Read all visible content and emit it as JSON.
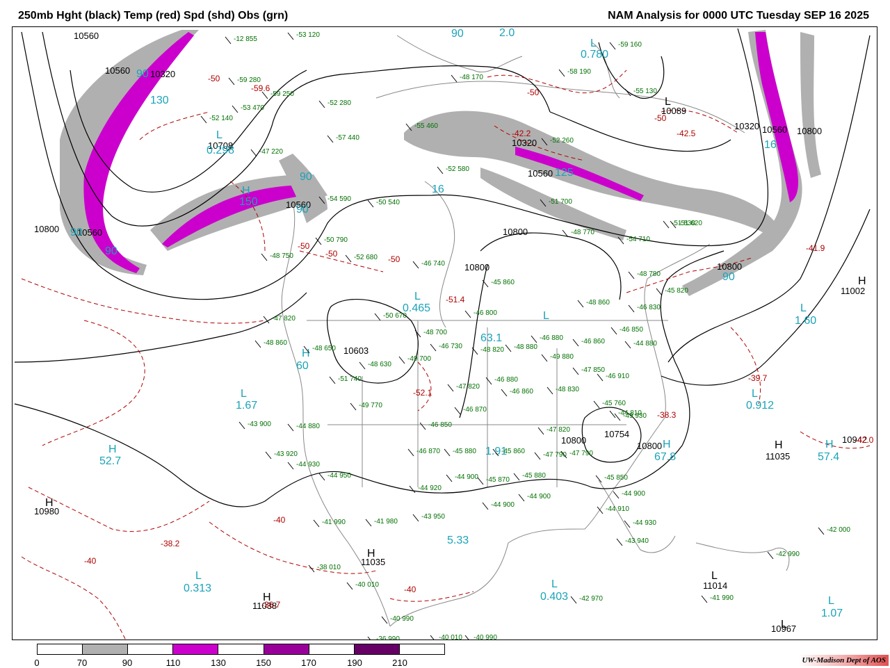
{
  "title_left": "250mb Hght (black) Temp (red) Spd (shd) Obs (grn)",
  "title_right": "NAM Analysis for 0000 UTC Tuesday  SEP 16 2025",
  "credit": "UW-Madison  Dept of AOS",
  "colors": {
    "height": "#000000",
    "temperature": "#b00000",
    "speed_label": "#1aa3b8",
    "obs": "#007000",
    "shade_70": "#b0b0b0",
    "shade_110": "#cc00cc",
    "shade_150": "#990099",
    "shade_190": "#660066",
    "border": "#888888"
  },
  "scale": {
    "ticks": [
      "0",
      "70",
      "90",
      "110",
      "130",
      "150",
      "170",
      "190",
      "210"
    ],
    "segment_colors": [
      "#ffffff",
      "#b0b0b0",
      "#ffffff",
      "#cc00cc",
      "#ffffff",
      "#990099",
      "#ffffff",
      "#660066",
      "#ffffff"
    ]
  },
  "height_labels": [
    "10560",
    "10560",
    "10320",
    "10708",
    "10560",
    "10800",
    "10560",
    "10603",
    "10800",
    "10800",
    "10320",
    "10560",
    "10089",
    "10320",
    "10560",
    "10800",
    "10800",
    "11002",
    "10754",
    "10800",
    "10800",
    "11035",
    "10942",
    "10980",
    "11035",
    "11038",
    "11014",
    "10967"
  ],
  "temp_labels": [
    "-50",
    "-59.6",
    "-50",
    "-50",
    "-50",
    "-50",
    "-42.2",
    "-50",
    "-42.5",
    "-41.9",
    "-51.4",
    "-52.1",
    "-39.7",
    "-38.3",
    "-40",
    "-40",
    "-38.2",
    "-40",
    "-36.7",
    "-42.0"
  ],
  "speed_labels": [
    "90",
    "130",
    "90",
    "0.298",
    "150",
    "90",
    "90",
    "90",
    "60",
    "0.465",
    "63.1",
    "1.67",
    "90",
    "2.0",
    "0.780",
    "125",
    "16",
    "1.60",
    "0.912",
    "67.8",
    "57.4",
    "52.7",
    "1.91",
    "5.33",
    "0.313",
    "0.403",
    "1.07",
    "16",
    "90"
  ],
  "obs_labels": [
    "-12 855",
    "-53 120",
    "-59 280",
    "-59 250",
    "-53 470",
    "-52 140",
    "-47 220",
    "-52 280",
    "-57 440",
    "-55 460",
    "-52 580",
    "-54 590",
    "-50 540",
    "-48 170",
    "-59 160",
    "-58 190",
    "-55 130",
    "-52 260",
    "-51 700",
    "-48 770",
    "-54 710",
    "-51 830",
    "-51 620",
    "-50 790",
    "-48 750",
    "-52 680",
    "-46 740",
    "-45 860",
    "-48 780",
    "-45 820",
    "-48 860",
    "-46 830",
    "-47 820",
    "-48 860",
    "-50 670",
    "-48 650",
    "-48 700",
    "-46 730",
    "-46 800",
    "-48 820",
    "-48 880",
    "-46 880",
    "-49 880",
    "-46 850",
    "-44 880",
    "-46 860",
    "-46 910",
    "-48 630",
    "-49 700",
    "-47 850",
    "-47 820",
    "-46 880",
    "-46 860",
    "-51 740",
    "-49 770",
    "-48 830",
    "-45 760",
    "-44 810",
    "-43 900",
    "-44 880",
    "-47 820",
    "-46 870",
    "-46 850",
    "-47 790",
    "-47 790",
    "-43 920",
    "-44 930",
    "-44 950",
    "-46 870",
    "-45 880",
    "-45 860",
    "-44 900",
    "-45 870",
    "-45 880",
    "-44 900",
    "-45 850",
    "-44 900",
    "-44 910",
    "-44 920",
    "-43 950",
    "-44 900",
    "-44 930",
    "-43 940",
    "-41 990",
    "-41 980",
    "-38 010",
    "-40 010",
    "-40 990",
    "-40 010",
    "-40 990",
    "-42 000",
    "-42 990",
    "-42 970",
    "-41 990",
    "-36 990",
    "-49 930"
  ]
}
